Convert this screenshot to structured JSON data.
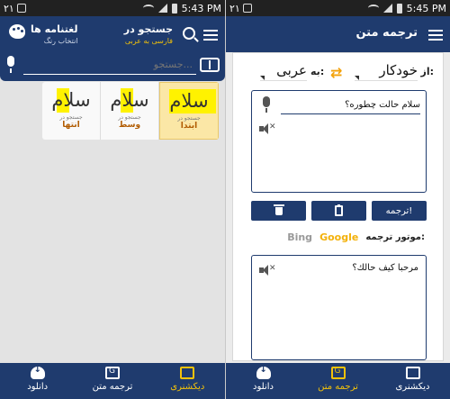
{
  "left": {
    "status": {
      "signal": "۲۱",
      "time": "5:43 PM"
    },
    "header": {
      "search_title": "جستجو در",
      "search_sub": "فارسی به عربی",
      "dict_title": "لغتنامه ها",
      "dict_sub": "انتخاب رنگ"
    },
    "search": {
      "placeholder": "جستجو..."
    },
    "modes": [
      {
        "word": "سلام",
        "cap1": "جستجو در",
        "cap2": "ابتدا"
      },
      {
        "word": "سلام",
        "cap1": "جستجو در",
        "cap2": "وسط"
      },
      {
        "word": "سلام",
        "cap1": "جستجو در",
        "cap2": "انتها"
      }
    ],
    "nav": {
      "dict": "دیکشنری",
      "trans": "ترجمه متن",
      "download": "دانلود"
    }
  },
  "right": {
    "status": {
      "signal": "۲۱",
      "time": "5:45 PM"
    },
    "header": {
      "title": "ترجمه متن"
    },
    "langs": {
      "from_label": "از:",
      "from": "خودکار",
      "to_label": "به:",
      "to": "عربی"
    },
    "input_text": "سلام حالت چطوره؟",
    "buttons": {
      "translate": "ترجمه!"
    },
    "engine": {
      "label": "موتور ترجمه:",
      "google": "Google",
      "bing": "Bing"
    },
    "output_text": "مرحبا كيف حالك؟",
    "nav": {
      "dict": "دیکشنری",
      "trans": "ترجمه متن",
      "download": "دانلود"
    }
  },
  "colors": {
    "primary": "#1f3b6e",
    "accent": "#f3c20a",
    "highlight": "#fff200"
  }
}
